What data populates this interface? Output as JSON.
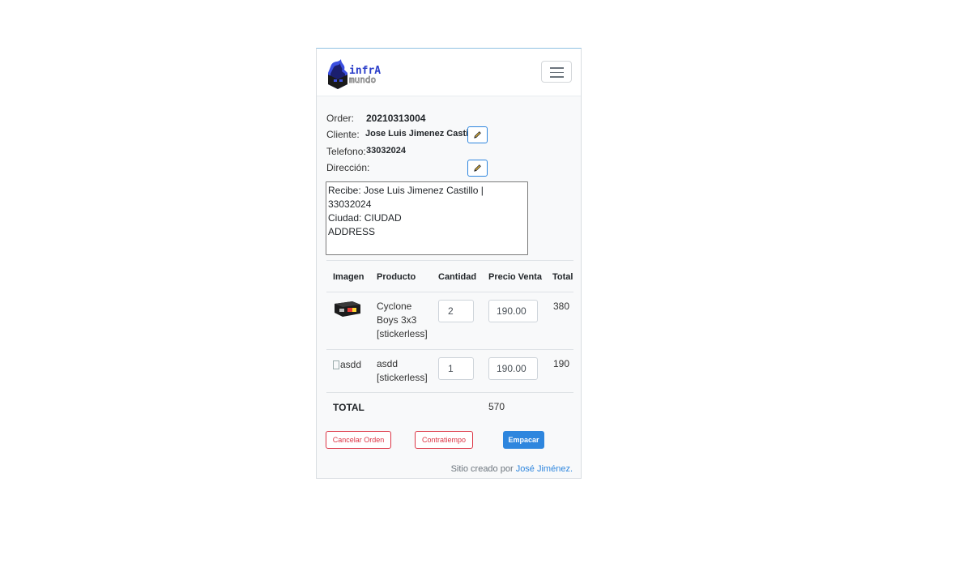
{
  "brand": {
    "logo_top": "infrA",
    "logo_bottom": "mundo",
    "logo_alt": "InfraMundo"
  },
  "navbar": {
    "toggle_label": "Toggle navigation"
  },
  "order": {
    "order_label": "Order:",
    "order_value": "20210313004",
    "cliente_label": "Cliente:",
    "cliente_value": "Jose Luis Jimenez Castillo",
    "telefono_label": "Telefono:",
    "telefono_value": "33032024",
    "direccion_label": "Dirección:",
    "direccion_text": "Recibe: Jose Luis Jimenez Castillo | 33032024\nCiudad: CIUDAD\nADDRESS"
  },
  "table": {
    "headers": [
      "Imagen",
      "Producto",
      "Cantidad",
      "Precio Venta",
      "Total"
    ],
    "rows": [
      {
        "image_alt": "",
        "product_line1": "Cyclone",
        "product_line2": "Boys 3x3",
        "product_line3": "[stickerless]",
        "cantidad": "2",
        "precio": "190.00",
        "total": "380"
      },
      {
        "image_alt": "asdd",
        "product_line1": "asdd",
        "product_line2": "[stickerless]",
        "product_line3": "",
        "cantidad": "1",
        "precio": "190.00",
        "total": "190"
      }
    ],
    "total_label": "TOTAL",
    "total_value": "570"
  },
  "actions": {
    "cancel_label": "Cancelar Orden",
    "setback_label": "Contratiempo",
    "pack_label": "Empacar"
  },
  "footer": {
    "text": "Sitio creado por",
    "author": "José Jiménez."
  },
  "colors": {
    "accent": "#2e86de",
    "danger": "#dc3545",
    "background": "#f8f9fa"
  },
  "icons": {
    "edit": "pencil-icon",
    "menu": "hamburger-icon"
  }
}
